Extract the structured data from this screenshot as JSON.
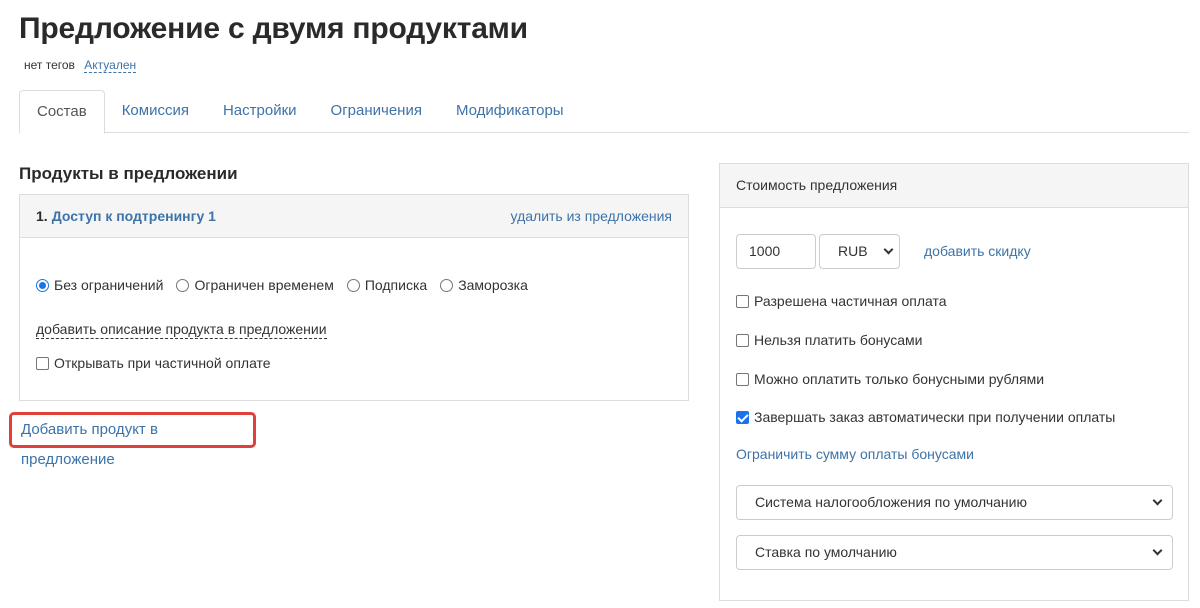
{
  "header": {
    "title": "Предложение с двумя продуктами",
    "tags_text": "нет тегов",
    "status_link": "Актуален"
  },
  "tabs": [
    {
      "label": "Состав",
      "active": true
    },
    {
      "label": "Комиссия",
      "active": false
    },
    {
      "label": "Настройки",
      "active": false
    },
    {
      "label": "Ограничения",
      "active": false
    },
    {
      "label": "Модификаторы",
      "active": false
    }
  ],
  "products_section": {
    "title": "Продукты в предложении",
    "product": {
      "number": "1.",
      "name": "Доступ к подтренингу 1",
      "remove_label": "удалить из предложения",
      "access_options": [
        {
          "label": "Без ограничений",
          "selected": true
        },
        {
          "label": "Ограничен временем",
          "selected": false
        },
        {
          "label": "Подписка",
          "selected": false
        },
        {
          "label": "Заморозка",
          "selected": false
        }
      ],
      "add_description_label": "добавить описание продукта в предложении",
      "open_on_partial_label": "Открывать при частичной оплате",
      "open_on_partial_checked": false
    },
    "add_product_label": "Добавить продукт в предложение"
  },
  "price_panel": {
    "title": "Стоимость предложения",
    "price_value": "1000",
    "currency": "RUB",
    "add_discount_label": "добавить скидку",
    "options": [
      {
        "label": "Разрешена частичная оплата",
        "checked": false
      },
      {
        "label": "Нельзя платить бонусами",
        "checked": false
      },
      {
        "label": "Можно оплатить только бонусными рублями",
        "checked": false
      },
      {
        "label": "Завершать заказ автоматически при получении оплаты",
        "checked": true
      }
    ],
    "limit_bonus_label": "Ограничить сумму оплаты бонусами",
    "tax_system_value": "Система налогообложения по умолчанию",
    "vat_rate_value": "Ставка по умолчанию"
  },
  "colors": {
    "link": "#3d73a8",
    "highlight_border": "#e0403a",
    "checked_blue": "#1a73e8"
  }
}
